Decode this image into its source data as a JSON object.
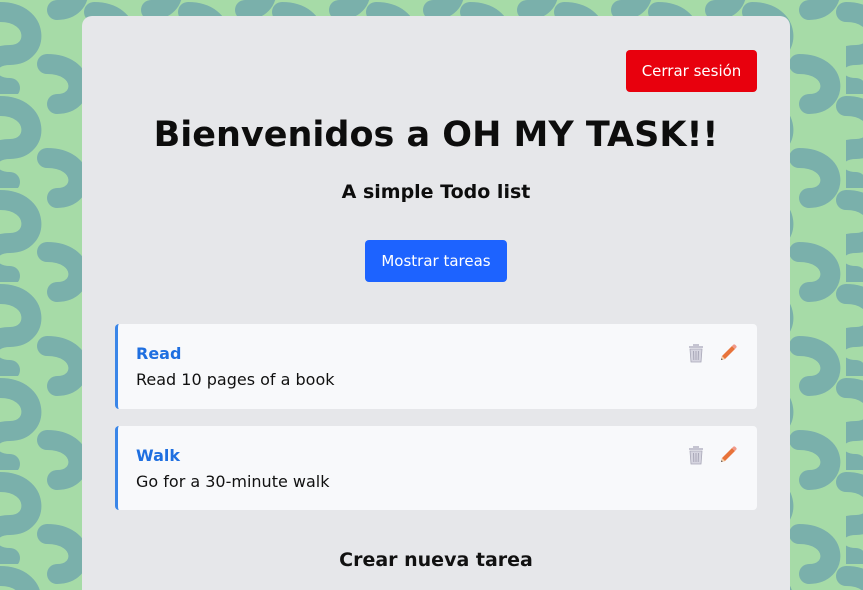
{
  "header": {
    "logout_label": "Cerrar sesión",
    "title": "Bienvenidos a OH MY TASK!!",
    "subtitle": "A simple Todo list",
    "show_tasks_label": "Mostrar tareas"
  },
  "tasks": [
    {
      "title": "Read",
      "description": "Read 10 pages of a book",
      "delete_icon": "trash-icon",
      "edit_icon": "pencil-icon"
    },
    {
      "title": "Walk",
      "description": "Go for a 30-minute walk",
      "delete_icon": "trash-icon",
      "edit_icon": "pencil-icon"
    }
  ],
  "create_section": {
    "title": "Crear nueva tarea"
  },
  "colors": {
    "background": "#a6dba7",
    "pattern": "#7ab0ab",
    "card": "#e6e7ea",
    "logout": "#e8000d",
    "primary": "#1d63ff",
    "task_accent": "#3a86e8",
    "task_title": "#1f6fe0",
    "edit_icon": "#e8733a"
  }
}
